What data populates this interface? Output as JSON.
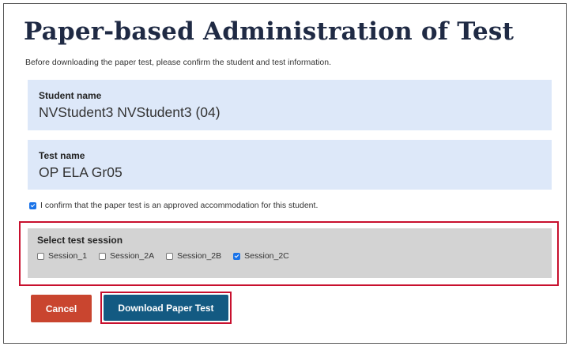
{
  "page": {
    "title": "Paper-based Administration of Test",
    "subtitle": "Before downloading the paper test, please confirm the student and test information."
  },
  "student": {
    "label": "Student name",
    "value": "NVStudent3 NVStudent3 (04)"
  },
  "test": {
    "label": "Test name",
    "value": "OP ELA Gr05"
  },
  "confirm": {
    "label": "I confirm that the paper test is an approved accommodation for this student.",
    "checked": true
  },
  "session": {
    "label": "Select test session",
    "options": [
      {
        "label": "Session_1",
        "checked": false
      },
      {
        "label": "Session_2A",
        "checked": false
      },
      {
        "label": "Session_2B",
        "checked": false
      },
      {
        "label": "Session_2C",
        "checked": true
      }
    ]
  },
  "buttons": {
    "cancel": "Cancel",
    "download": "Download Paper Test"
  },
  "colors": {
    "info_bg": "#dde8f9",
    "session_bg": "#d3d3d3",
    "highlight": "#c8102e",
    "cancel": "#c9452f",
    "download": "#135a82",
    "checkbox": "#1a73e8"
  }
}
